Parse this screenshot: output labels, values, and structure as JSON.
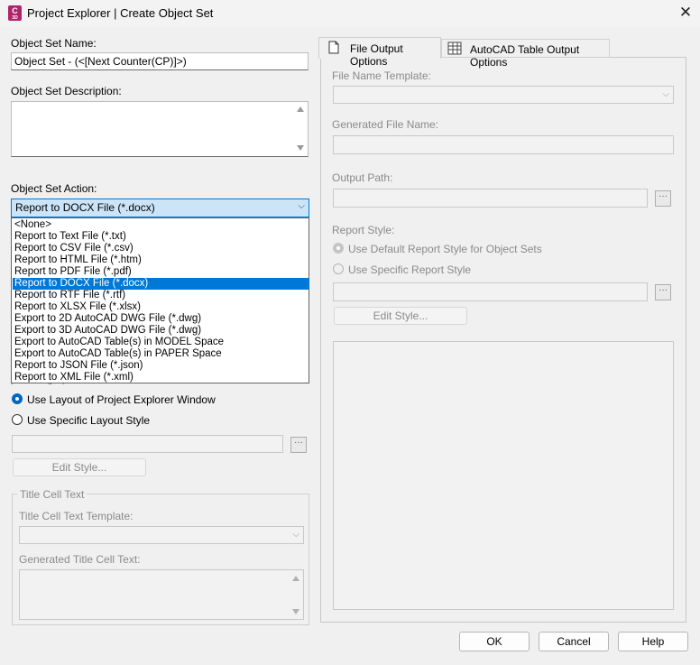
{
  "window": {
    "title": "Project Explorer | Create Object Set",
    "app_icon_letter": "C",
    "app_icon_sub": "3D",
    "close_glyph": "✕"
  },
  "left": {
    "name_label": "Object Set Name:",
    "name_value": "Object Set - (<[Next Counter(CP)]>)",
    "description_label": "Object Set Description:",
    "description_value": "",
    "action_label": "Object Set Action:",
    "action_value": "Report to DOCX File (*.docx)",
    "action_options": [
      "<None>",
      "Report to Text File (*.txt)",
      "Report to CSV File (*.csv)",
      "Report to HTML File (*.htm)",
      "Report to PDF File (*.pdf)",
      "Report to DOCX File (*.docx)",
      "Report to RTF File (*.rtf)",
      "Report to XLSX File (*.xlsx)",
      "Export to 2D AutoCAD DWG File (*.dwg)",
      "Export to 3D AutoCAD DWG File (*.dwg)",
      "Export to AutoCAD Table(s) in MODEL Space",
      "Export to AutoCAD Table(s) in PAPER Space",
      "Report to JSON File (*.json)",
      "Report to XML File (*.xml)"
    ],
    "action_selected_index": 5,
    "layout_style_label": "Layout Style:",
    "use_layout_window": "Use Layout of Project Explorer Window",
    "use_specific_layout": "Use Specific Layout Style",
    "layout_edit_style": "Edit Style...",
    "title_cell_group": "Title Cell Text",
    "title_cell_template_label": "Title Cell Text Template:",
    "generated_title_label": "Generated Title Cell Text:"
  },
  "right": {
    "tabs": [
      "File Output Options",
      "AutoCAD Table Output Options"
    ],
    "active_tab": 0,
    "file_name_template_label": "File Name Template:",
    "generated_file_name_label": "Generated File Name:",
    "output_path_label": "Output Path:",
    "report_style_label": "Report Style:",
    "use_default_report_style": "Use Default Report Style for Object Sets",
    "use_specific_report_style": "Use Specific Report Style",
    "report_edit_style": "Edit Style..."
  },
  "footer": {
    "ok": "OK",
    "cancel": "Cancel",
    "help": "Help"
  },
  "icons": {
    "ellipsis": "···",
    "chevron": "⌵"
  }
}
